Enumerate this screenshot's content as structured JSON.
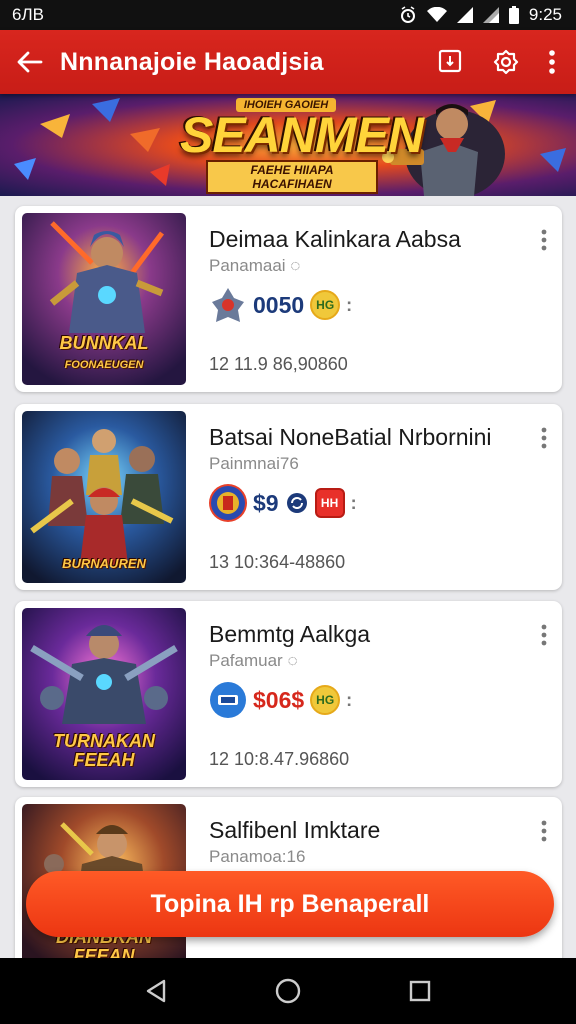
{
  "status_bar": {
    "left_text": "6ЛВ",
    "time": "9:25",
    "icons": [
      "alarm-icon",
      "wifi-icon",
      "signal-icon",
      "signal-icon",
      "battery-icon"
    ]
  },
  "app_bar": {
    "title": "Nnnanajoie Haoadjsia",
    "back_icon": "arrow-left-icon",
    "actions": [
      "bookmark-icon",
      "settings-icon",
      "more-vertical-icon"
    ],
    "color": "#d8261e"
  },
  "banner": {
    "top_text": "IHOIEH GAOIEH",
    "title": "SEANMEN",
    "subtitle": "FAEHE HIIAPA HACAFIHAEN"
  },
  "cards": [
    {
      "title": "Deimaa Kalinkara Aabsa",
      "subtitle": "Panamaai",
      "value": "0050",
      "value_color": "blue",
      "badge_text": "HG",
      "stats": "12 11.9 86,90860",
      "thumb_caption": "BUNNKAL",
      "thumb_caption_2": "FOONAEUGEN"
    },
    {
      "title": "Batsai NoneBatial Nrbornini",
      "subtitle": "Painmnai76",
      "value": "$9",
      "value_color": "blue",
      "badge_text": "HH",
      "stats": "13 10:364-48860",
      "thumb_caption": "BURNAUREN",
      "thumb_caption_2": ""
    },
    {
      "title": "Bemmtg Aalkga",
      "subtitle": "Pafamuar",
      "value": "$06$",
      "value_color": "red",
      "badge_text": "HG",
      "stats": "12 10:8.47.96860",
      "thumb_caption": "TURNAKAN",
      "thumb_caption_2": "FEEAH"
    },
    {
      "title": "Salfibenl Imktare",
      "subtitle": "Panamoa:16",
      "value": "",
      "value_color": "blue",
      "badge_text": "",
      "stats": "",
      "thumb_caption": "DIANBKAN",
      "thumb_caption_2": "FEEAN"
    }
  ],
  "cta": {
    "label": "Topina IH  rp Benaperall",
    "color": "#ff5a26"
  },
  "nav_bar": {
    "icons": [
      "back-triangle-icon",
      "home-circle-icon",
      "recents-square-icon"
    ]
  }
}
